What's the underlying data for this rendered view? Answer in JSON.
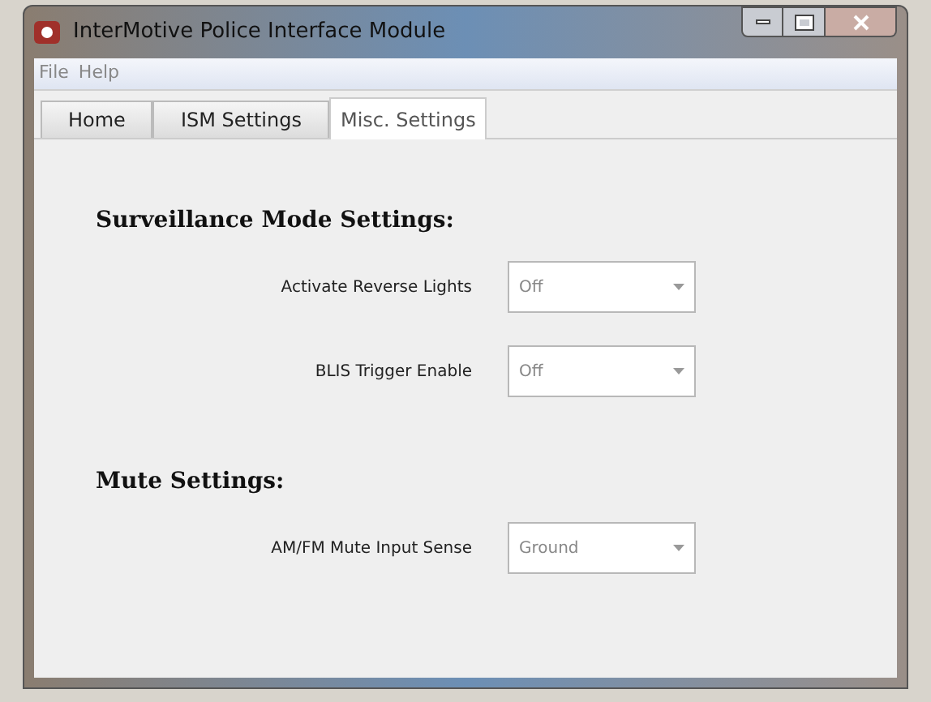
{
  "window": {
    "title": "InterMotive Police Interface Module"
  },
  "menu": [
    "File",
    "Help"
  ],
  "tabs": [
    {
      "label": "Home",
      "selected": false
    },
    {
      "label": "ISM Settings",
      "selected": false
    },
    {
      "label": "Misc. Settings",
      "selected": true
    }
  ],
  "sections": [
    {
      "title": "Surveillance Mode Settings:",
      "settings": [
        {
          "label": "Activate Reverse Lights",
          "value": "Off"
        },
        {
          "label": "BLIS Trigger Enable",
          "value": "Off"
        }
      ]
    },
    {
      "title": "Mute Settings:",
      "settings": [
        {
          "label": "AM/FM Mute Input Sense",
          "value": "Ground"
        }
      ]
    }
  ]
}
